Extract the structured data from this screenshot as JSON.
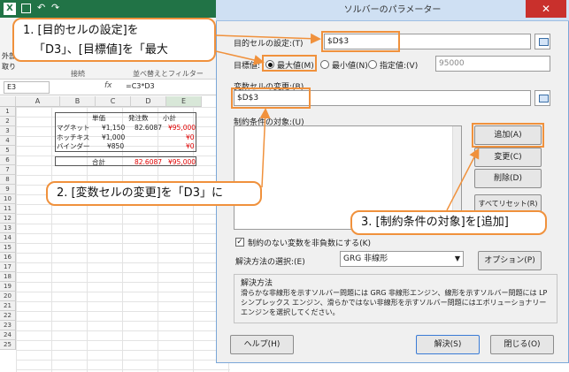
{
  "excel": {
    "ribbon_left": "外部",
    "ribbon_left2": "取り",
    "ribbon_connect": "接続",
    "ribbon_sort": "並べ替えとフィルター",
    "cell_ref": "E3",
    "fx": "fx",
    "formula": "=C3*D3",
    "columns": [
      "A",
      "B",
      "C",
      "D",
      "E"
    ],
    "rows": [
      "1",
      "2",
      "3",
      "4",
      "5",
      "6",
      "7",
      "8",
      "9",
      "10",
      "11",
      "12",
      "13",
      "14",
      "15",
      "16",
      "17",
      "18",
      "19",
      "20",
      "21",
      "22",
      "23",
      "24",
      "25"
    ],
    "headers": {
      "price": "単価",
      "qty": "発注数",
      "subtotal": "小計"
    },
    "items": [
      {
        "name": "マグネット",
        "price": "¥1,150",
        "qty": "82.6087",
        "subtotal": "¥95,000"
      },
      {
        "name": "ホッチキス",
        "price": "¥1,000",
        "qty": "",
        "subtotal": "¥0"
      },
      {
        "name": "バインダー",
        "price": "¥850",
        "qty": "",
        "subtotal": "¥0"
      }
    ],
    "total": {
      "label": "合計",
      "qty": "82.6087",
      "subtotal": "¥95,000"
    }
  },
  "dialog": {
    "title": "ソルバーのパラメーター",
    "close": "✕",
    "objective_label": "目的セルの設定:(T)",
    "objective_value": "$D$3",
    "target_label": "目標値:",
    "opt_max": "最大値(M)",
    "opt_min": "最小値(N)",
    "opt_value": "指定値:(V)",
    "value_field": "95000",
    "changing_label": "変数セルの変更:(B)",
    "changing_value": "$D$3",
    "constraints_label": "制約条件の対象:(U)",
    "btn_add": "追加(A)",
    "btn_change": "変更(C)",
    "btn_delete": "削除(D)",
    "btn_reset": "すべてリセット(R)",
    "nonneg_label": "制約のない変数を非負数にする(K)",
    "method_label": "解決方法の選択:(E)",
    "method_value": "GRG 非線形",
    "btn_options": "オプション(P)",
    "group_title": "解決方法",
    "group_desc": "滑らかな非線形を示すソルバー問題には GRG 非線形エンジン、線形を示すソルバー問題には LP シンプレックス エンジン、滑らかではない非線形を示すソルバー問題にはエボリューショナリー エンジンを選択してください。",
    "btn_help": "ヘルプ(H)",
    "btn_solve": "解決(S)",
    "btn_close": "閉じる(O)"
  },
  "callouts": {
    "c1_line1": "1. [目的セルの設定]を",
    "c1_line2": "「D3」、[目標値]を「最大",
    "c2": "2. [変数セルの変更]を「D3」に",
    "c3": "3. [制約条件の対象]を[追加]"
  },
  "colors": {
    "accent": "#f0913c",
    "excel_green": "#217346",
    "red": "#e00000"
  }
}
